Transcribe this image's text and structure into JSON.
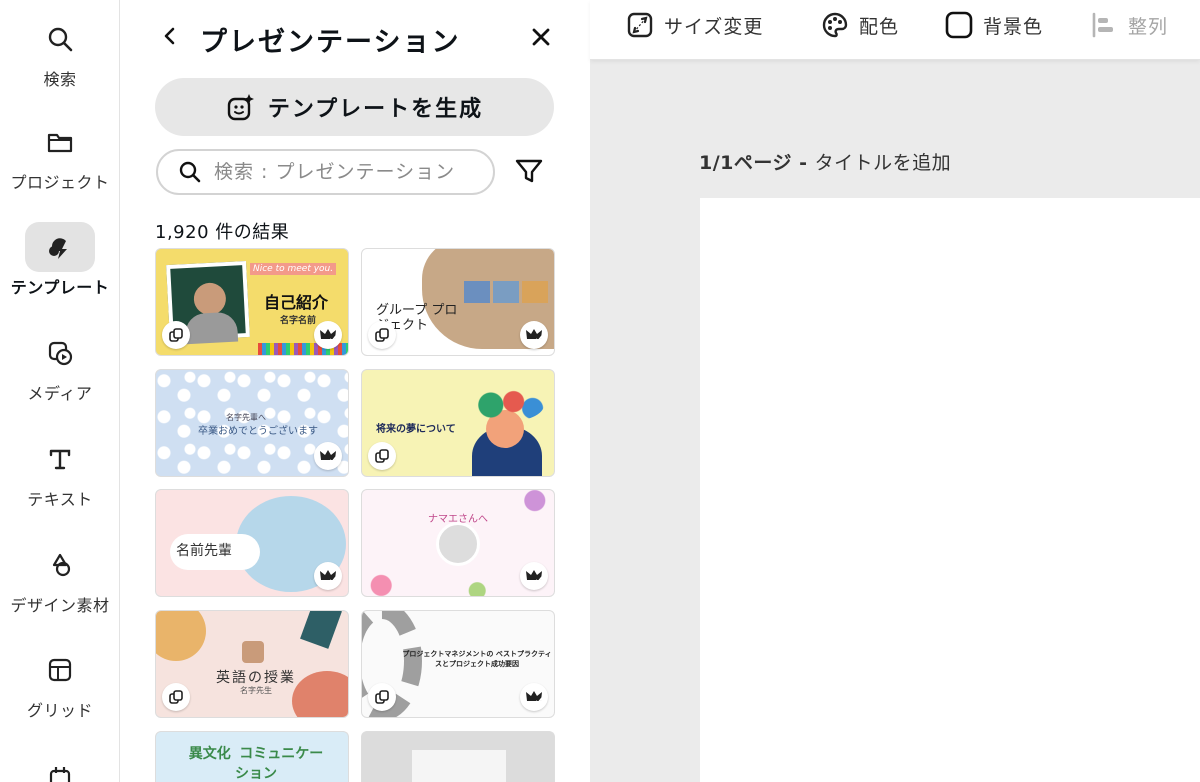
{
  "rail": {
    "items": [
      {
        "label": "検索",
        "icon": "search-icon"
      },
      {
        "label": "プロジェクト",
        "icon": "folder-icon"
      },
      {
        "label": "テンプレート",
        "icon": "templates-icon"
      },
      {
        "label": "メディア",
        "icon": "media-icon"
      },
      {
        "label": "テキスト",
        "icon": "text-icon"
      },
      {
        "label": "デザイン素材",
        "icon": "design-elements-icon"
      },
      {
        "label": "グリッド",
        "icon": "grid-icon"
      }
    ]
  },
  "panel": {
    "title": "プレゼンテーション",
    "generate_label": "テンプレートを生成",
    "search_placeholder": "検索 : プレゼンテーション",
    "result_count": "1,920 件の結果",
    "cards": [
      {
        "title": "自己紹介",
        "subtitle": "名字名前",
        "badge": "Nice to meet you.",
        "premium": true,
        "duplicate": true
      },
      {
        "title": "グループ プロジェクト",
        "premium": true,
        "duplicate": true
      },
      {
        "title": "卒業おめでとうございます",
        "subtitle": "名字先輩へ",
        "premium": true,
        "duplicate": false
      },
      {
        "title": "将来の夢について",
        "premium": false,
        "duplicate": true
      },
      {
        "title": "名前先輩",
        "premium": true,
        "duplicate": false
      },
      {
        "title": "ナマエさんへ",
        "premium": true,
        "duplicate": false
      },
      {
        "title": "英語の授業",
        "subtitle": "名字先生",
        "premium": false,
        "duplicate": true
      },
      {
        "title": "プロジェクトマネジメントの ベストプラクティスとプロジェクト成功要因",
        "premium": true,
        "duplicate": true
      },
      {
        "title": "異文化 コミュニケーション",
        "premium": false,
        "duplicate": false
      },
      {
        "title": "",
        "premium": false,
        "duplicate": false
      }
    ]
  },
  "toolbar": {
    "resize": "サイズ変更",
    "color": "配色",
    "background": "背景色",
    "align": "整列"
  },
  "canvas": {
    "page_number": "1/1ページ",
    "separator": " - ",
    "title_placeholder": "タイトルを追加"
  }
}
